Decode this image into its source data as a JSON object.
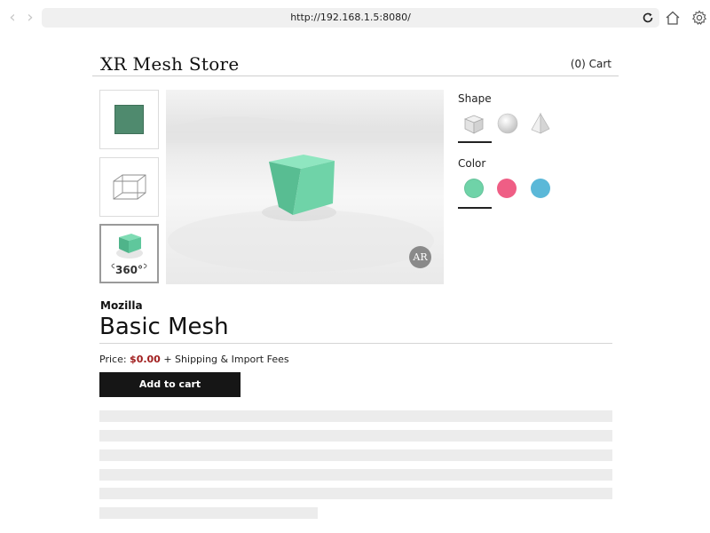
{
  "browser": {
    "url": "http://192.168.1.5:8080/",
    "back_icon": "chevron-left-icon",
    "forward_icon": "chevron-right-icon",
    "reload_icon": "reload-icon",
    "home_icon": "home-icon",
    "settings_icon": "gear-icon"
  },
  "header": {
    "store_name": "XR Mesh Store",
    "cart_label": "(0) Cart"
  },
  "gallery": {
    "thumbnails": [
      "flat-color-swatch",
      "wireframe-cube",
      "rotatable-3d-model"
    ],
    "selected_thumbnail": 2,
    "label_360": "360°",
    "ar_badge": "AR"
  },
  "options": {
    "shape_label": "Shape",
    "shapes": [
      "cube",
      "sphere",
      "pyramid"
    ],
    "selected_shape": "cube",
    "color_label": "Color",
    "colors": [
      {
        "name": "mint",
        "hex": "#6fd3a8"
      },
      {
        "name": "pink",
        "hex": "#ef5e85"
      },
      {
        "name": "blue",
        "hex": "#5bb8d8"
      }
    ],
    "selected_color": "mint"
  },
  "product": {
    "brand": "Mozilla",
    "title": "Basic Mesh",
    "price_prefix": "Price: ",
    "price": "$0.00",
    "price_suffix": " + Shipping & Import Fees",
    "add_to_cart": "Add to cart"
  },
  "colors": {
    "price": "#a11f1f",
    "button_bg": "#161616",
    "cube_face": "#6fd3a8"
  }
}
